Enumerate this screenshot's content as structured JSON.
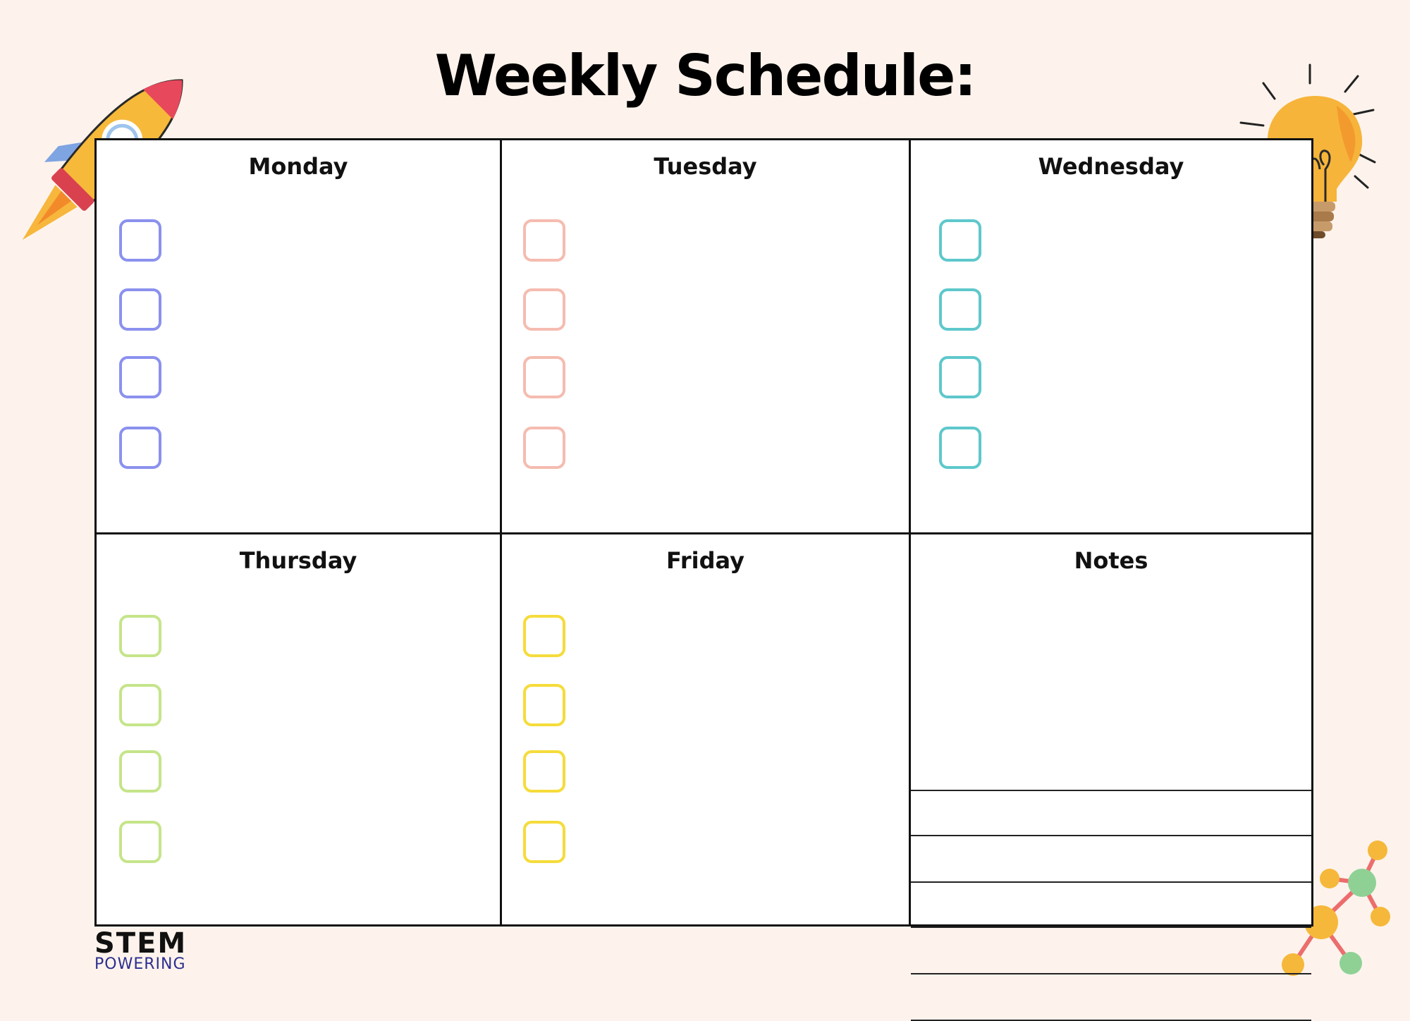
{
  "title": "Weekly Schedule:",
  "days": [
    {
      "label": "Monday",
      "color": "#8b91ee"
    },
    {
      "label": "Tuesday",
      "color": "#f5bcb0"
    },
    {
      "label": "Wednesday",
      "color": "#5ec8cc"
    },
    {
      "label": "Thursday",
      "color": "#c5e58a"
    },
    {
      "label": "Friday",
      "color": "#f5dc3a"
    }
  ],
  "notes": {
    "label": "Notes"
  },
  "logo": {
    "top": "STEM",
    "bottom": "POWERING"
  },
  "icons": [
    "rocket-icon",
    "lightbulb-icon",
    "molecule-icon"
  ]
}
